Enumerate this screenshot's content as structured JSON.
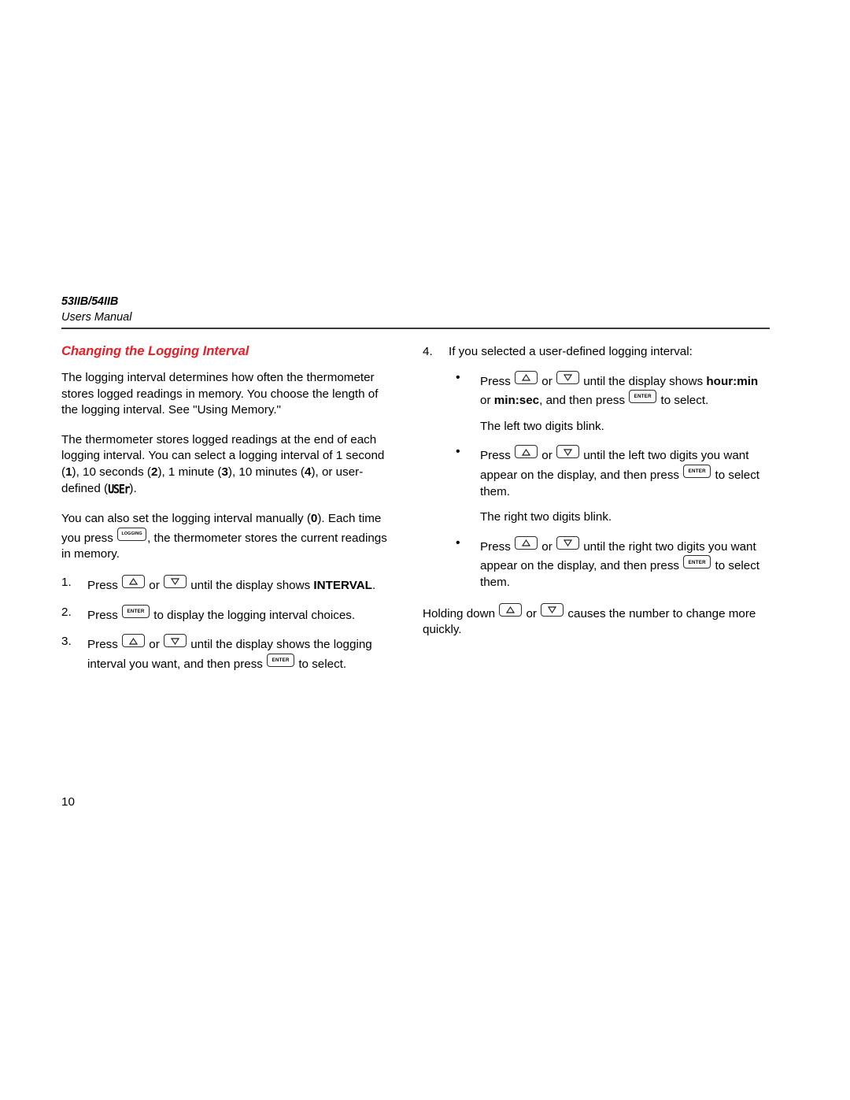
{
  "header": {
    "model": "53IIB/54IIB",
    "subtitle": "Users Manual"
  },
  "heading": {
    "text": "Changing the Logging Interval",
    "color": "#ED1C24"
  },
  "left_column": {
    "paragraph_1": "The logging interval determines how often the thermometer stores logged readings in memory. You choose the length of the logging interval. See \"Using Memory.\"",
    "paragraph_2": {
      "part_1": "The thermometer stores logged readings at the end of each logging interval. You can select a logging interval of 1 second (",
      "opt_1": "1",
      "part_2": "), 10 seconds (",
      "opt_2": "2",
      "part_3": "), 1 minute (",
      "opt_3": "3",
      "part_4": "), 10 minutes (",
      "opt_4": "4",
      "part_5": "), or user-defined (",
      "lcd_user": "USEr",
      "part_6": ")."
    },
    "paragraph_3": {
      "part_1": "You can also set the logging interval manually (",
      "opt_0": "0",
      "part_2": "). Each time you press ",
      "key_logging": "LOGGING",
      "part_3": ", the thermometer stores the current readings in memory."
    },
    "steps": [
      {
        "number": "1.",
        "part_1": "Press ",
        "key_up": "up-arrow",
        "part_2": " or ",
        "key_down": "down-arrow",
        "part_3": " until the display shows ",
        "bold": "INTERVAL",
        "part_4": "."
      },
      {
        "number": "2.",
        "part_1": "Press ",
        "key_enter": "ENTER",
        "part_2": " to display the logging interval choices."
      },
      {
        "number": "3.",
        "part_1": "Press ",
        "key_up": "up-arrow",
        "part_2": " or ",
        "key_down": "down-arrow",
        "part_3": " until the display shows the logging interval you want, and then press ",
        "key_enter": "ENTER",
        "part_4": " to select."
      }
    ]
  },
  "right_column": {
    "step_4": {
      "number": "4.",
      "text": "If you selected a user-defined logging interval:"
    },
    "bullets": [
      {
        "part_1": "Press ",
        "key_up": "up-arrow",
        "part_2": " or ",
        "key_down": "down-arrow",
        "part_3": " until the display shows ",
        "bold_1": "hour:min",
        "part_4": " or ",
        "bold_2": "min:sec",
        "part_5": ", and then press ",
        "key_enter": "ENTER",
        "part_6": " to select."
      },
      {
        "part_1": "Press ",
        "key_up": "up-arrow",
        "part_2": " or ",
        "key_down": "down-arrow",
        "part_3": " until the left two digits you want appear on the display, and then press ",
        "key_enter": "ENTER",
        "part_4": " to select them."
      },
      {
        "part_1": "Press ",
        "key_up": "up-arrow",
        "part_2": " or ",
        "key_down": "down-arrow",
        "part_3": " until the right two digits you want appear on the display, and then press ",
        "key_enter": "ENTER",
        "part_4": " to select them."
      }
    ],
    "note_left_digits": "The left two digits blink.",
    "note_right_digits": "The right two digits blink.",
    "closing": {
      "part_1": "Holding down ",
      "key_up": "up-arrow",
      "part_2": " or ",
      "key_down": "down-arrow",
      "part_3": " causes the number to change more quickly."
    }
  },
  "footer": {
    "page_number": "10"
  }
}
